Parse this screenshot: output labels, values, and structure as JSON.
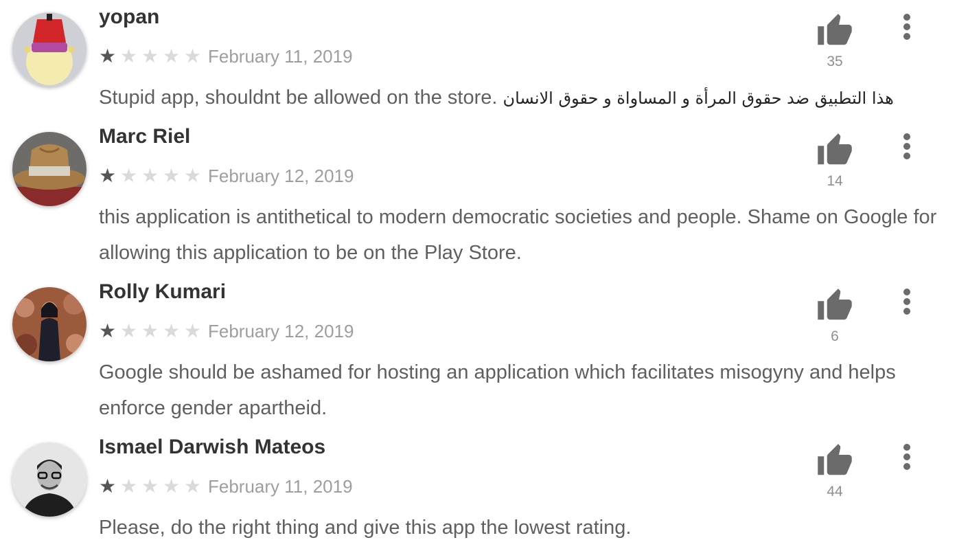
{
  "reviews": [
    {
      "author": "yopan",
      "avatar_icon": "avatar-red-fez-icon",
      "rating": 1,
      "max_rating": 5,
      "date": "February 11, 2019",
      "text_en": "Stupid app, shouldnt be allowed on the store. ",
      "text_ar": "هذا التطبيق ضد حقوق المرأة و المساواة و حقوق الانسان",
      "helpful_count": "35"
    },
    {
      "author": "Marc Riel",
      "avatar_icon": "avatar-brown-hat-icon",
      "rating": 1,
      "max_rating": 5,
      "date": "February 12, 2019",
      "text_en": "this application is antithetical to modern democratic societies and people. Shame on Google for allowing this application to be on the Play Store.",
      "text_ar": "",
      "helpful_count": "14"
    },
    {
      "author": "Rolly Kumari",
      "avatar_icon": "avatar-woman-photo-icon",
      "rating": 1,
      "max_rating": 5,
      "date": "February 12, 2019",
      "text_en": "Google should be ashamed for hosting an application which facilitates misogyny and helps enforce gender apartheid.",
      "text_ar": "",
      "helpful_count": "6"
    },
    {
      "author": "Ismael Darwish Mateos",
      "avatar_icon": "avatar-man-glasses-icon",
      "rating": 1,
      "max_rating": 5,
      "date": "February 11, 2019",
      "text_en": "Please, do the right thing and give this app the lowest rating.",
      "text_ar": "",
      "helpful_count": "44"
    }
  ],
  "icons": {
    "helpful": "thumbs-up-icon",
    "menu": "more-vert-icon",
    "star": "star-icon"
  },
  "colors": {
    "author": "#333333",
    "date": "#9e9e9e",
    "body": "#5f5f5f",
    "star_filled": "#555555",
    "star_empty": "#dadada",
    "icon": "#6b6b6b"
  }
}
